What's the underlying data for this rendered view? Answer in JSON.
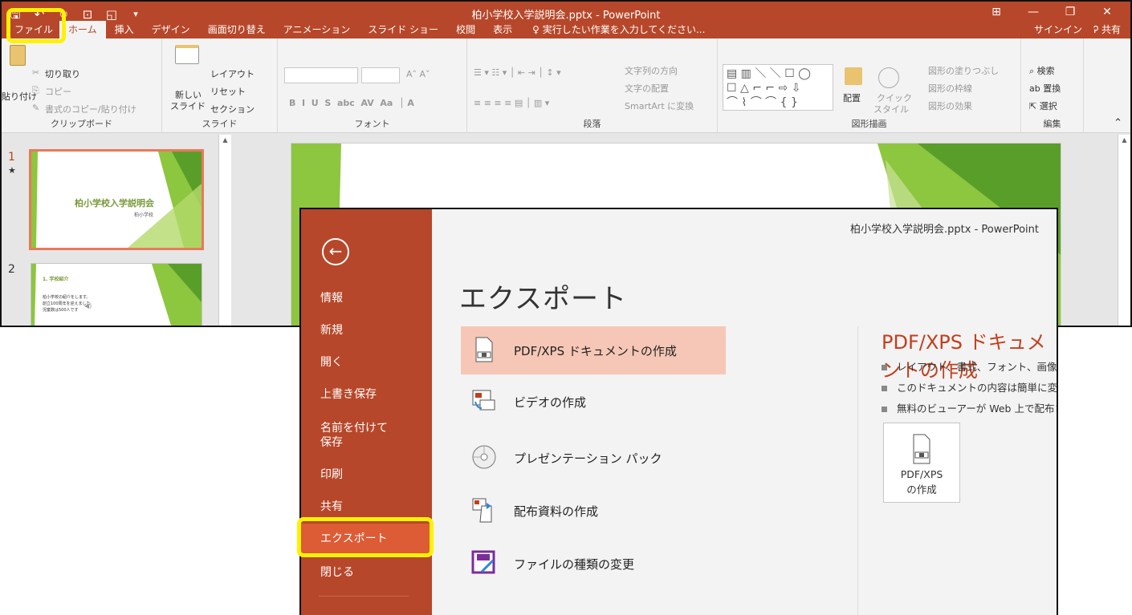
{
  "window": {
    "title": "柏小学校入学説明会.pptx - PowerPoint"
  },
  "tabs": {
    "file": "ファイル",
    "home": "ホーム",
    "insert": "挿入",
    "design": "デザイン",
    "transitions": "画面切り替え",
    "animations": "アニメーション",
    "slideshow": "スライド ショー",
    "review": "校閲",
    "view": "表示",
    "tell_me": "実行したい作業を入力してください...",
    "signin": "サインイン",
    "share": "共有"
  },
  "ribbon": {
    "clipboard": {
      "paste": "貼り付け",
      "cut": "切り取り",
      "copy": "コピー",
      "format_painter": "書式のコピー/貼り付け",
      "label": "クリップボード"
    },
    "slides": {
      "new_slide_1": "新しい",
      "new_slide_2": "スライド",
      "layout": "レイアウト",
      "reset": "リセット",
      "section": "セクション",
      "label": "スライド"
    },
    "font": {
      "label": "フォント"
    },
    "paragraph": {
      "text_direction": "文字列の方向",
      "align_text": "文字の配置",
      "smartart": "SmartArt に変換",
      "label": "段落"
    },
    "drawing": {
      "arrange": "配置",
      "quick_styles_1": "クイック",
      "quick_styles_2": "スタイル",
      "shape_fill": "図形の塗りつぶし",
      "shape_outline": "図形の枠線",
      "shape_effects": "図形の効果",
      "label": "図形描画"
    },
    "editing": {
      "find": "検索",
      "replace": "置換",
      "select": "選択",
      "label": "編集"
    }
  },
  "thumbnails": {
    "slide1": {
      "number": "1",
      "star": "★",
      "title": "柏小学校入学説明会",
      "subtitle": "柏小学校"
    },
    "slide2": {
      "number": "2",
      "heading": "1. 学校紹介",
      "line1": "柏小学校の紹介をします。",
      "line2": "創立100周年を迎えました",
      "line3": "児童数は500人です"
    }
  },
  "backstage": {
    "back_glyph": "←",
    "doc_title": "柏小学校入学説明会.pptx - PowerPoint",
    "menu": {
      "info": "情報",
      "new": "新規",
      "open": "開く",
      "save": "上書き保存",
      "save_as_1": "名前を付けて",
      "save_as_2": "保存",
      "print": "印刷",
      "share": "共有",
      "export": "エクスポート",
      "close": "閉じる"
    },
    "heading": "エクスポート",
    "options": {
      "pdf": "PDF/XPS ドキュメントの作成",
      "video": "ビデオの作成",
      "package": "プレゼンテーション パック",
      "handouts": "配布資料の作成",
      "change_type": "ファイルの種類の変更"
    },
    "details": {
      "title": "PDF/XPS ドキュメントの作成",
      "bullet1": "レイアウト、書式、フォント、画像がそのまま維持されます",
      "bullet2": "このドキュメントの内容は簡単に変更できません",
      "bullet3": "無料のビューアーが Web 上で配布されています",
      "button_line1": "PDF/XPS",
      "button_line2": "の作成"
    }
  },
  "colors": {
    "ppt_accent": "#b7472a",
    "selected_menu": "#dd5b35",
    "selected_option": "#f6c7b6",
    "highlight": "#fff200",
    "slide_green": "#8dc63f"
  }
}
